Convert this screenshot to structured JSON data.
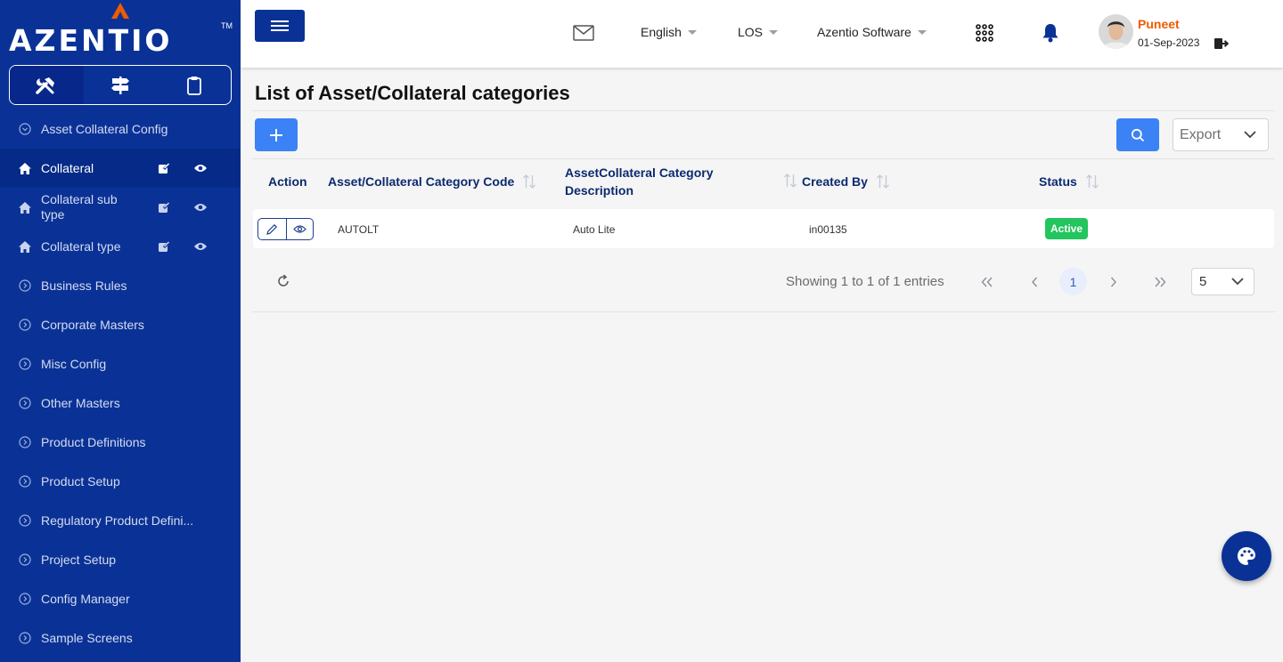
{
  "app": {
    "logo_text": "AZENTIO",
    "logo_tm": "TM"
  },
  "header": {
    "language": "English",
    "module": "LOS",
    "company": "Azentio Software",
    "user_name": "Puneet",
    "user_date": "01-Sep-2023"
  },
  "sidebar": {
    "items": [
      {
        "label": "Asset Collateral Config",
        "icon": "chevron-circle-icon"
      },
      {
        "label": "Collateral",
        "icon": "home-icon",
        "active": true
      },
      {
        "label": "Collateral sub type",
        "icon": "home-icon"
      },
      {
        "label": "Collateral type",
        "icon": "home-icon"
      },
      {
        "label": "Business Rules",
        "icon": "chevron-circle-icon"
      },
      {
        "label": "Corporate Masters",
        "icon": "chevron-circle-icon"
      },
      {
        "label": "Misc Config",
        "icon": "chevron-circle-icon"
      },
      {
        "label": "Other Masters",
        "icon": "chevron-circle-icon"
      },
      {
        "label": "Product Definitions",
        "icon": "chevron-circle-icon"
      },
      {
        "label": "Product Setup",
        "icon": "chevron-circle-icon"
      },
      {
        "label": "Regulatory Product Defini...",
        "icon": "chevron-circle-icon"
      },
      {
        "label": "Project Setup",
        "icon": "chevron-circle-icon"
      },
      {
        "label": "Config Manager",
        "icon": "chevron-circle-icon"
      },
      {
        "label": "Sample Screens",
        "icon": "chevron-circle-icon"
      }
    ]
  },
  "page": {
    "title": "List of Asset/Collateral categories"
  },
  "toolbar": {
    "export_label": "Export"
  },
  "table": {
    "columns": [
      "Action",
      "Asset/Collateral Category Code",
      "AssetCollateral Category Description",
      "Created By",
      "Status"
    ],
    "rows": [
      {
        "code": "AUTOLT",
        "description": "Auto Lite",
        "created_by": "in00135",
        "status": "Active"
      }
    ]
  },
  "pagination": {
    "showing": "Showing 1 to 1 of 1 entries",
    "current_page": "1",
    "page_size": "5"
  },
  "colors": {
    "sidebar": "#0a3296",
    "accent": "#3b82f6",
    "status_active": "#22c55e",
    "user_name": "#f05a00"
  }
}
